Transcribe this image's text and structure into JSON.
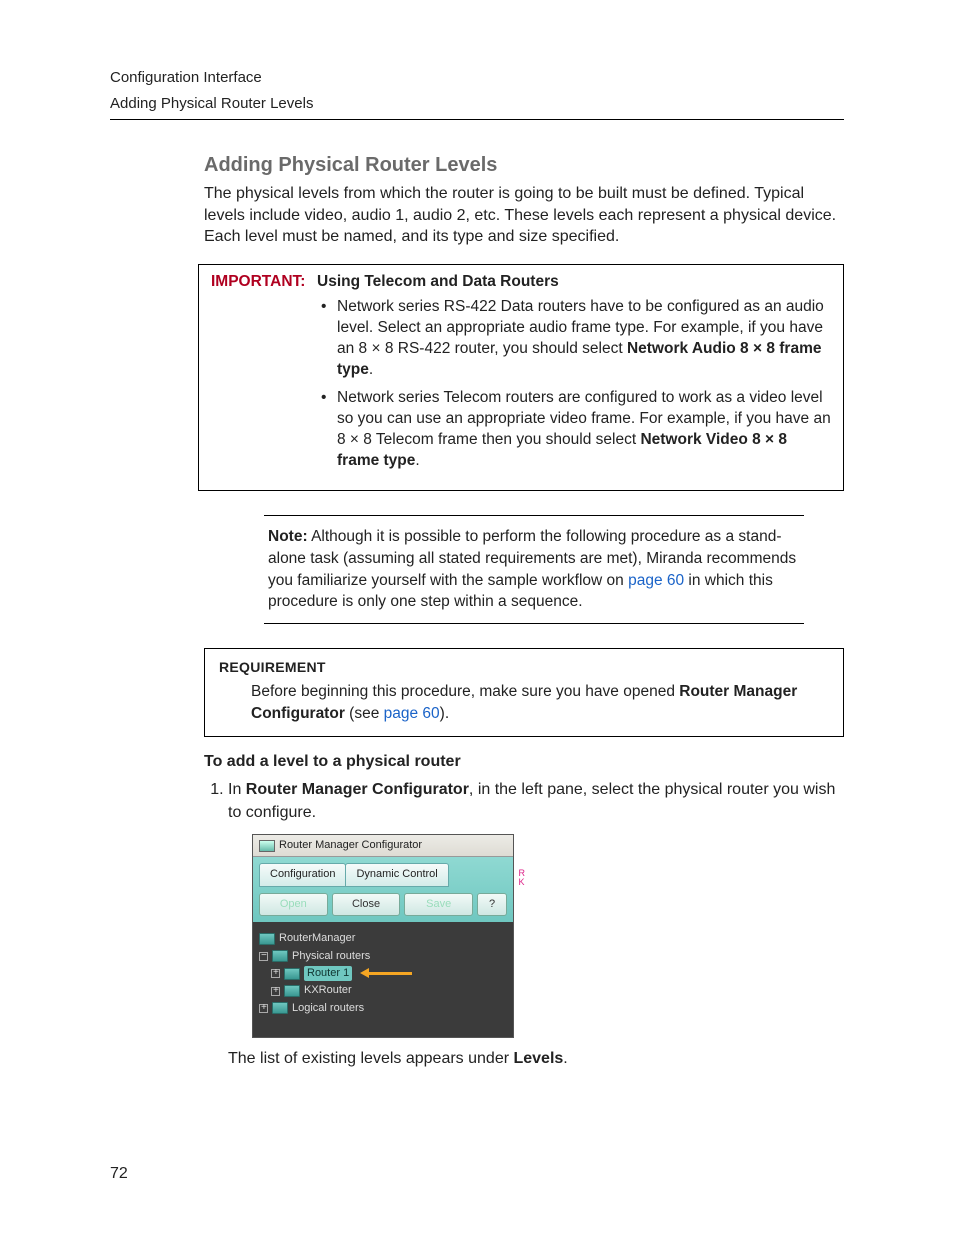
{
  "header": {
    "line1": "Configuration Interface",
    "line2": "Adding Physical Router Levels"
  },
  "section": {
    "title": "Adding Physical Router Levels",
    "intro": "The physical levels from which the router is going to be built must be defined. Typical levels include video, audio 1, audio 2, etc. These levels each represent a physical device. Each level must be named, and its type and size specified."
  },
  "important": {
    "label": "IMPORTANT:",
    "title": "Using Telecom and Data Routers",
    "bullet1a": "Network series RS-422 Data routers have to be configured as an audio level. Select an appropriate audio frame type. For example, if you have an 8 × 8 RS-422 router, you should select ",
    "bullet1b": "Network Audio 8 × 8 frame type",
    "bullet1c": ".",
    "bullet2a": "Network series Telecom routers are configured to work as a video level so you can use an appropriate video frame. For example, if you have an 8 × 8 Telecom frame then you should select ",
    "bullet2b": "Network Video 8 × 8 frame type",
    "bullet2c": "."
  },
  "note": {
    "label": "Note:",
    "text1": "Although it is possible to perform the following procedure as a stand-alone task (assuming all stated requirements are met), Miranda recommends you familiarize yourself with the sample workflow on ",
    "link": "page 60",
    "text2": " in which this procedure is only one step within a sequence."
  },
  "requirement": {
    "title": "REQUIREMENT",
    "text1": "Before beginning this procedure, make sure you have opened ",
    "bold": "Router Manager Configurator",
    "text2": " (see ",
    "link": "page 60",
    "text3": ")."
  },
  "procedure": {
    "subhead": "To add a level to a physical router",
    "step1a": "In ",
    "step1b": "Router Manager Configurator",
    "step1c": ", in the left pane, select the physical router you wish to configure.",
    "after1a": "The list of existing levels appears under ",
    "after1b": "Levels",
    "after1c": "."
  },
  "screenshot": {
    "title": "Router Manager Configurator",
    "tabs": {
      "config": "Configuration",
      "dynamic": "Dynamic Control"
    },
    "buttons": {
      "open": "Open",
      "close": "Close",
      "save": "Save",
      "help": "?"
    },
    "tree": {
      "root": "RouterManager",
      "physical": "Physical routers",
      "router1": "Router 1",
      "kxrouter": "KXRouter",
      "logical": "Logical routers"
    },
    "strip": {
      "r": "R",
      "k": "K"
    }
  },
  "pageNumber": "72"
}
